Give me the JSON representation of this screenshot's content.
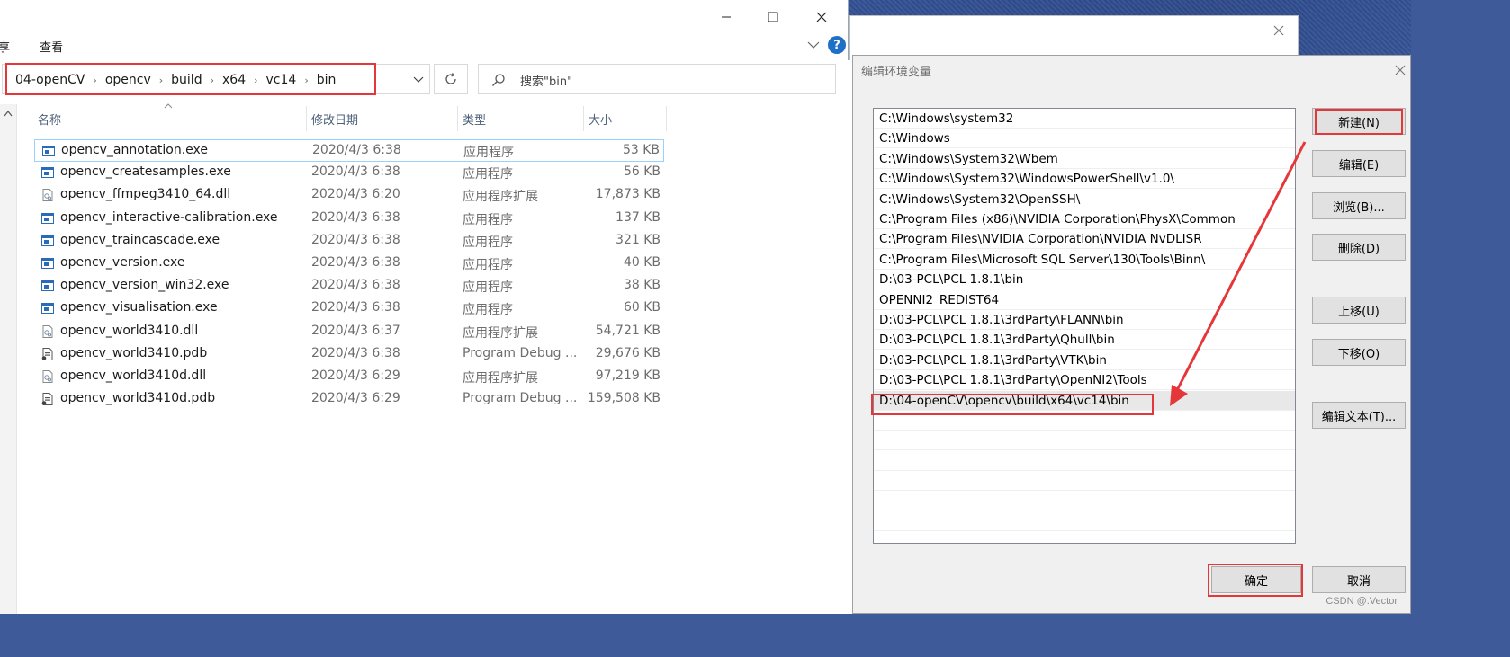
{
  "explorer": {
    "ribbon": {
      "share_tab": "享",
      "view_tab": "查看"
    },
    "breadcrumbs": [
      "04-openCV",
      "opencv",
      "build",
      "x64",
      "vc14",
      "bin"
    ],
    "search_placeholder": "搜索\"bin\"",
    "columns": {
      "name": "名称",
      "date": "修改日期",
      "type": "类型",
      "size": "大小"
    },
    "files": [
      {
        "name": "opencv_annotation.exe",
        "date": "2020/4/3 6:38",
        "type": "应用程序",
        "size": "53 KB",
        "icon": "exe-icon"
      },
      {
        "name": "opencv_createsamples.exe",
        "date": "2020/4/3 6:38",
        "type": "应用程序",
        "size": "56 KB",
        "icon": "exe-icon"
      },
      {
        "name": "opencv_ffmpeg3410_64.dll",
        "date": "2020/4/3 6:20",
        "type": "应用程序扩展",
        "size": "17,873 KB",
        "icon": "dll-icon"
      },
      {
        "name": "opencv_interactive-calibration.exe",
        "date": "2020/4/3 6:38",
        "type": "应用程序",
        "size": "137 KB",
        "icon": "exe-icon"
      },
      {
        "name": "opencv_traincascade.exe",
        "date": "2020/4/3 6:38",
        "type": "应用程序",
        "size": "321 KB",
        "icon": "exe-icon"
      },
      {
        "name": "opencv_version.exe",
        "date": "2020/4/3 6:38",
        "type": "应用程序",
        "size": "40 KB",
        "icon": "exe-icon"
      },
      {
        "name": "opencv_version_win32.exe",
        "date": "2020/4/3 6:38",
        "type": "应用程序",
        "size": "38 KB",
        "icon": "exe-icon"
      },
      {
        "name": "opencv_visualisation.exe",
        "date": "2020/4/3 6:38",
        "type": "应用程序",
        "size": "60 KB",
        "icon": "exe-icon"
      },
      {
        "name": "opencv_world3410.dll",
        "date": "2020/4/3 6:37",
        "type": "应用程序扩展",
        "size": "54,721 KB",
        "icon": "dll-icon"
      },
      {
        "name": "opencv_world3410.pdb",
        "date": "2020/4/3 6:38",
        "type": "Program Debug ...",
        "size": "29,676 KB",
        "icon": "pdb-icon"
      },
      {
        "name": "opencv_world3410d.dll",
        "date": "2020/4/3 6:29",
        "type": "应用程序扩展",
        "size": "97,219 KB",
        "icon": "dll-icon"
      },
      {
        "name": "opencv_world3410d.pdb",
        "date": "2020/4/3 6:29",
        "type": "Program Debug ...",
        "size": "159,508 KB",
        "icon": "pdb-icon"
      }
    ]
  },
  "env_dialog": {
    "title": "编辑环境变量",
    "paths": [
      "C:\\Windows\\system32",
      "C:\\Windows",
      "C:\\Windows\\System32\\Wbem",
      "C:\\Windows\\System32\\WindowsPowerShell\\v1.0\\",
      "C:\\Windows\\System32\\OpenSSH\\",
      "C:\\Program Files (x86)\\NVIDIA Corporation\\PhysX\\Common",
      "C:\\Program Files\\NVIDIA Corporation\\NVIDIA NvDLISR",
      "C:\\Program Files\\Microsoft SQL Server\\130\\Tools\\Binn\\",
      "D:\\03-PCL\\PCL 1.8.1\\bin",
      "OPENNI2_REDIST64",
      "D:\\03-PCL\\PCL 1.8.1\\3rdParty\\FLANN\\bin",
      "D:\\03-PCL\\PCL 1.8.1\\3rdParty\\Qhull\\bin",
      "D:\\03-PCL\\PCL 1.8.1\\3rdParty\\VTK\\bin",
      "D:\\03-PCL\\PCL 1.8.1\\3rdParty\\OpenNI2\\Tools",
      "D:\\04-openCV\\opencv\\build\\x64\\vc14\\bin"
    ],
    "buttons": {
      "new": "新建(N)",
      "edit": "编辑(E)",
      "browse": "浏览(B)...",
      "delete": "删除(D)",
      "move_up": "上移(U)",
      "move_down": "下移(O)",
      "edit_text": "编辑文本(T)...",
      "ok": "确定",
      "cancel": "取消"
    }
  },
  "watermark": "CSDN @.Vector",
  "colors": {
    "highlight": "#e5363a",
    "selection": "#99d1ff"
  }
}
